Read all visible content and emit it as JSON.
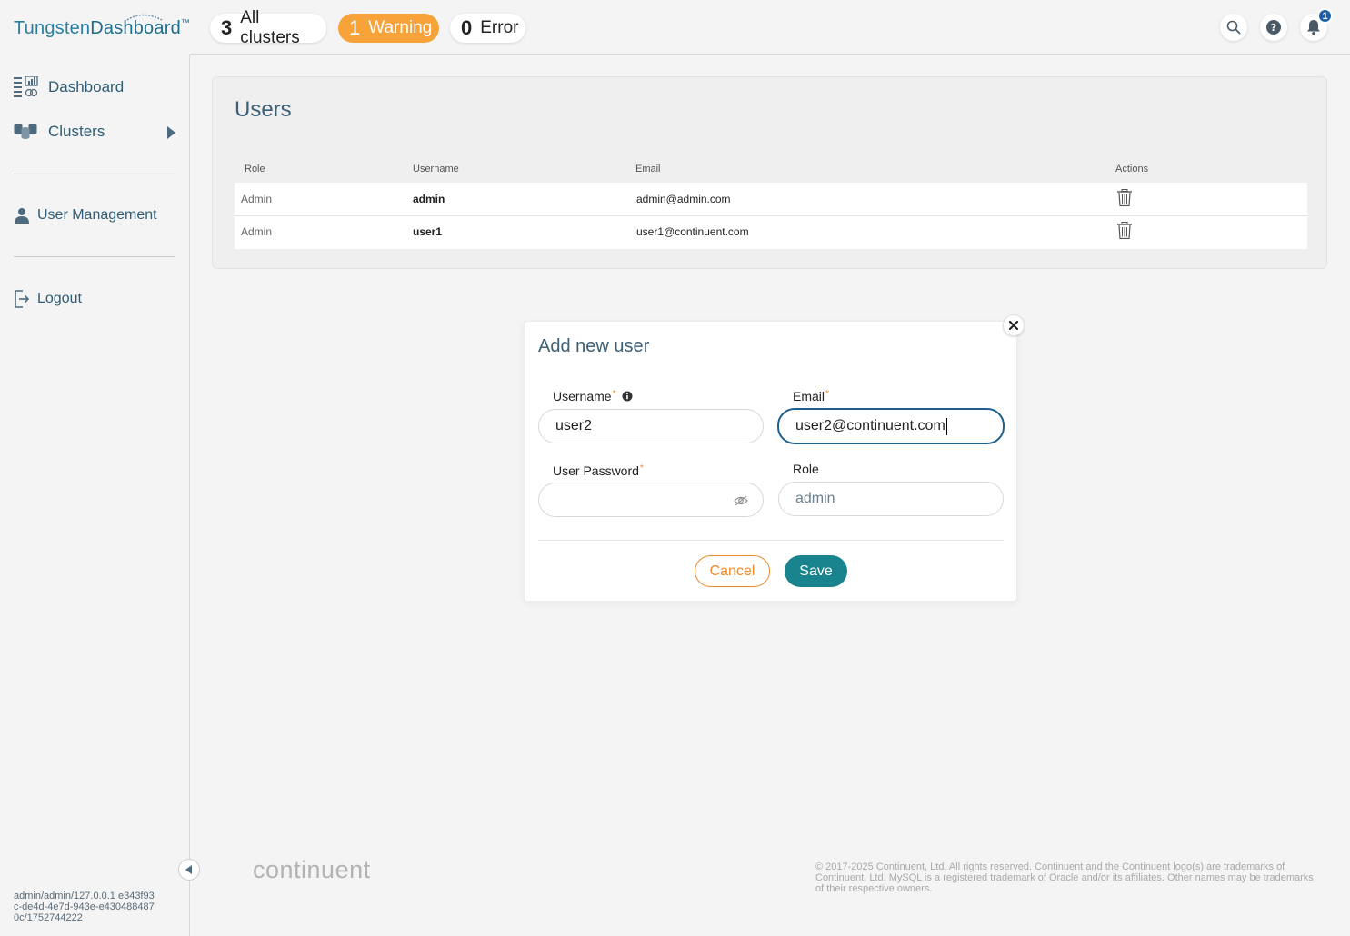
{
  "header": {
    "logo_part1": "Tungsten",
    "logo_part2": "Dashboard",
    "logo_tm": "™",
    "stats": {
      "all_count": "3",
      "all_label": "All clusters",
      "warning_count": "1",
      "warning_label": "Warning",
      "error_count": "0",
      "error_label": "Error"
    },
    "notification_count": "1",
    "icons": [
      "search-icon",
      "help-icon",
      "bell-icon"
    ]
  },
  "sidebar": {
    "items": [
      {
        "label": "Dashboard",
        "icon": "dashboard-icon"
      },
      {
        "label": "Clusters",
        "icon": "clusters-icon"
      },
      {
        "label": "User Management",
        "icon": "user-icon"
      },
      {
        "label": "Logout",
        "icon": "logout-icon"
      }
    ],
    "session_info": "admin/admin/127.0.0.1 e343f93c-de4d-4e7d-943e-e4304884870c/1752744222"
  },
  "users": {
    "title": "Users",
    "columns": [
      "Role",
      "Username",
      "Email",
      "Actions"
    ],
    "rows": [
      {
        "role": "Admin",
        "username": "admin",
        "email": "admin@admin.com"
      },
      {
        "role": "Admin",
        "username": "user1",
        "email": "user1@continuent.com"
      }
    ]
  },
  "modal": {
    "title": "Add new user",
    "username_label": "Username",
    "username_value": "user2",
    "email_label": "Email",
    "email_value": "user2@continuent.com",
    "password_label": "User Password",
    "password_value": "",
    "role_label": "Role",
    "role_value": "admin",
    "required_mark": "*",
    "cancel_label": "Cancel",
    "save_label": "Save"
  },
  "footer": {
    "brand": "continuent",
    "copyright": "© 2017-2025 Continuent, Ltd. All rights reserved. Continuent and the Continuent logo(s) are trademarks of Continuent, Ltd. MySQL is a registered trademark of Oracle and/or its affiliates. Other names may be trademarks of their respective owners."
  },
  "colors": {
    "accent_teal": "#19838e",
    "warning_orange": "#f7a33a",
    "nav_text": "#2f5d75",
    "badge_blue": "#1d5fa8"
  }
}
